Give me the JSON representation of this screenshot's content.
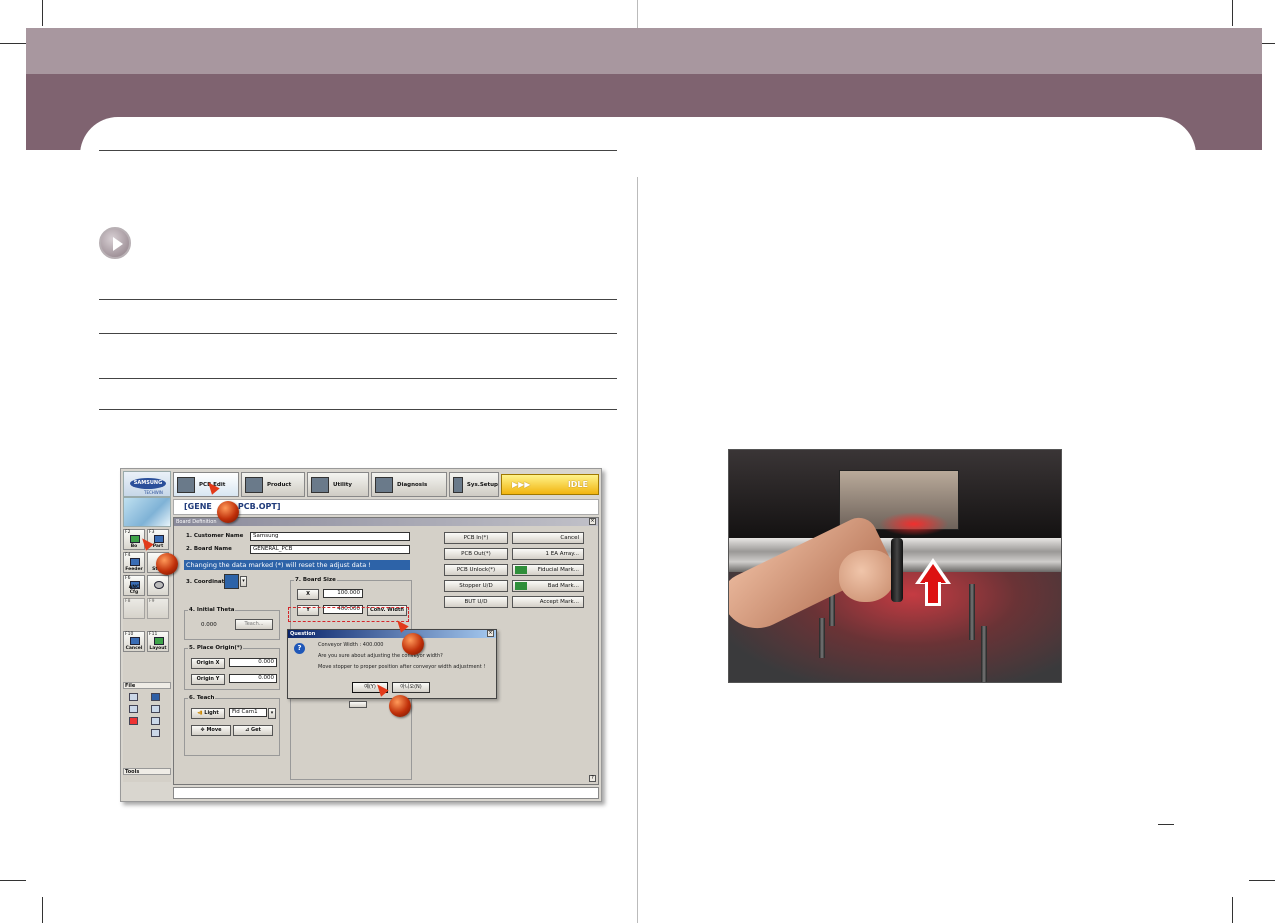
{
  "theme": {
    "band1": "#a8979f",
    "band2": "#7f6370",
    "accent": "#d4262a"
  },
  "app": {
    "logo": {
      "brand": "SAMSUNG",
      "sub": "TECHWIN"
    },
    "toolbar": {
      "pcb_edit": "PCB Edit",
      "product": "Product",
      "utility": "Utility",
      "diagnosis": "Diagnosis",
      "sys_setup": "Sys.Setup"
    },
    "status": {
      "arrows": "▶▶▶",
      "state": "IDLE"
    },
    "file_title": "[GENE",
    "file_title_tail": "PCB.OPT]",
    "sidebar": {
      "keys": [
        {
          "key": "F2",
          "label": "Bo"
        },
        {
          "key": "F3",
          "label": "Part"
        },
        {
          "key": "F4",
          "label": "Feeder"
        },
        {
          "key": "",
          "label": "Step"
        },
        {
          "key": "F6",
          "label": "ANC Cfg"
        },
        {
          "key": "",
          "label": ""
        },
        {
          "key": "F8",
          "label": ""
        },
        {
          "key": "F9",
          "label": ""
        },
        {
          "key": "F10",
          "label": "Cancel"
        },
        {
          "key": "F11",
          "label": "Layout"
        }
      ],
      "file": "File",
      "tools": "Tools"
    },
    "board_dialog": {
      "title": "Board Definition",
      "customer_label": "1. Customer Name",
      "customer_value": "Samsung",
      "board_label": "2. Board Name",
      "board_value": "GENERAL_PCB",
      "warning": "Changing the data marked (*) will reset the adjust data !",
      "coordinate_label": "3. Coordinate(*)",
      "theta_label": "4. Initial Theta",
      "theta_value": "0.000",
      "teach_btn": "Teach...",
      "board_size_label": "7. Board Size",
      "x_label": "X",
      "x_value": "100.000",
      "y_label": "Y",
      "y_value": "400.000",
      "conv_width": "Conv. Width",
      "origin_label": "5. Place Origin(*)",
      "origin_x_label": "Origin X",
      "origin_x_value": "0.000",
      "origin_y_label": "Origin Y",
      "origin_y_value": "0.000",
      "teach_group_label": "6. Teach",
      "light_btn": "Light",
      "camera_value": "Fid Cam1",
      "move_btn": "Move",
      "get_btn": "Get",
      "right_buttons": [
        "PCB In(*)",
        "PCB Out(*)",
        "PCB Unlock(*)",
        "Stopper U/D",
        "BUT U/D"
      ],
      "right_buttons2": [
        "Cancel",
        "1 EA       Array...",
        "Fiducial Mark...",
        "Bad Mark...",
        "Accept Mark..."
      ]
    },
    "question": {
      "title": "Question",
      "line1": "Conveyor Width : 400.000",
      "line2": "Are you sure about adjusting the conveyor width?",
      "line3": "Move stopper to proper position after conveyor width adjustment !",
      "yes": "예(Y)",
      "no": "아니오(N)"
    }
  }
}
